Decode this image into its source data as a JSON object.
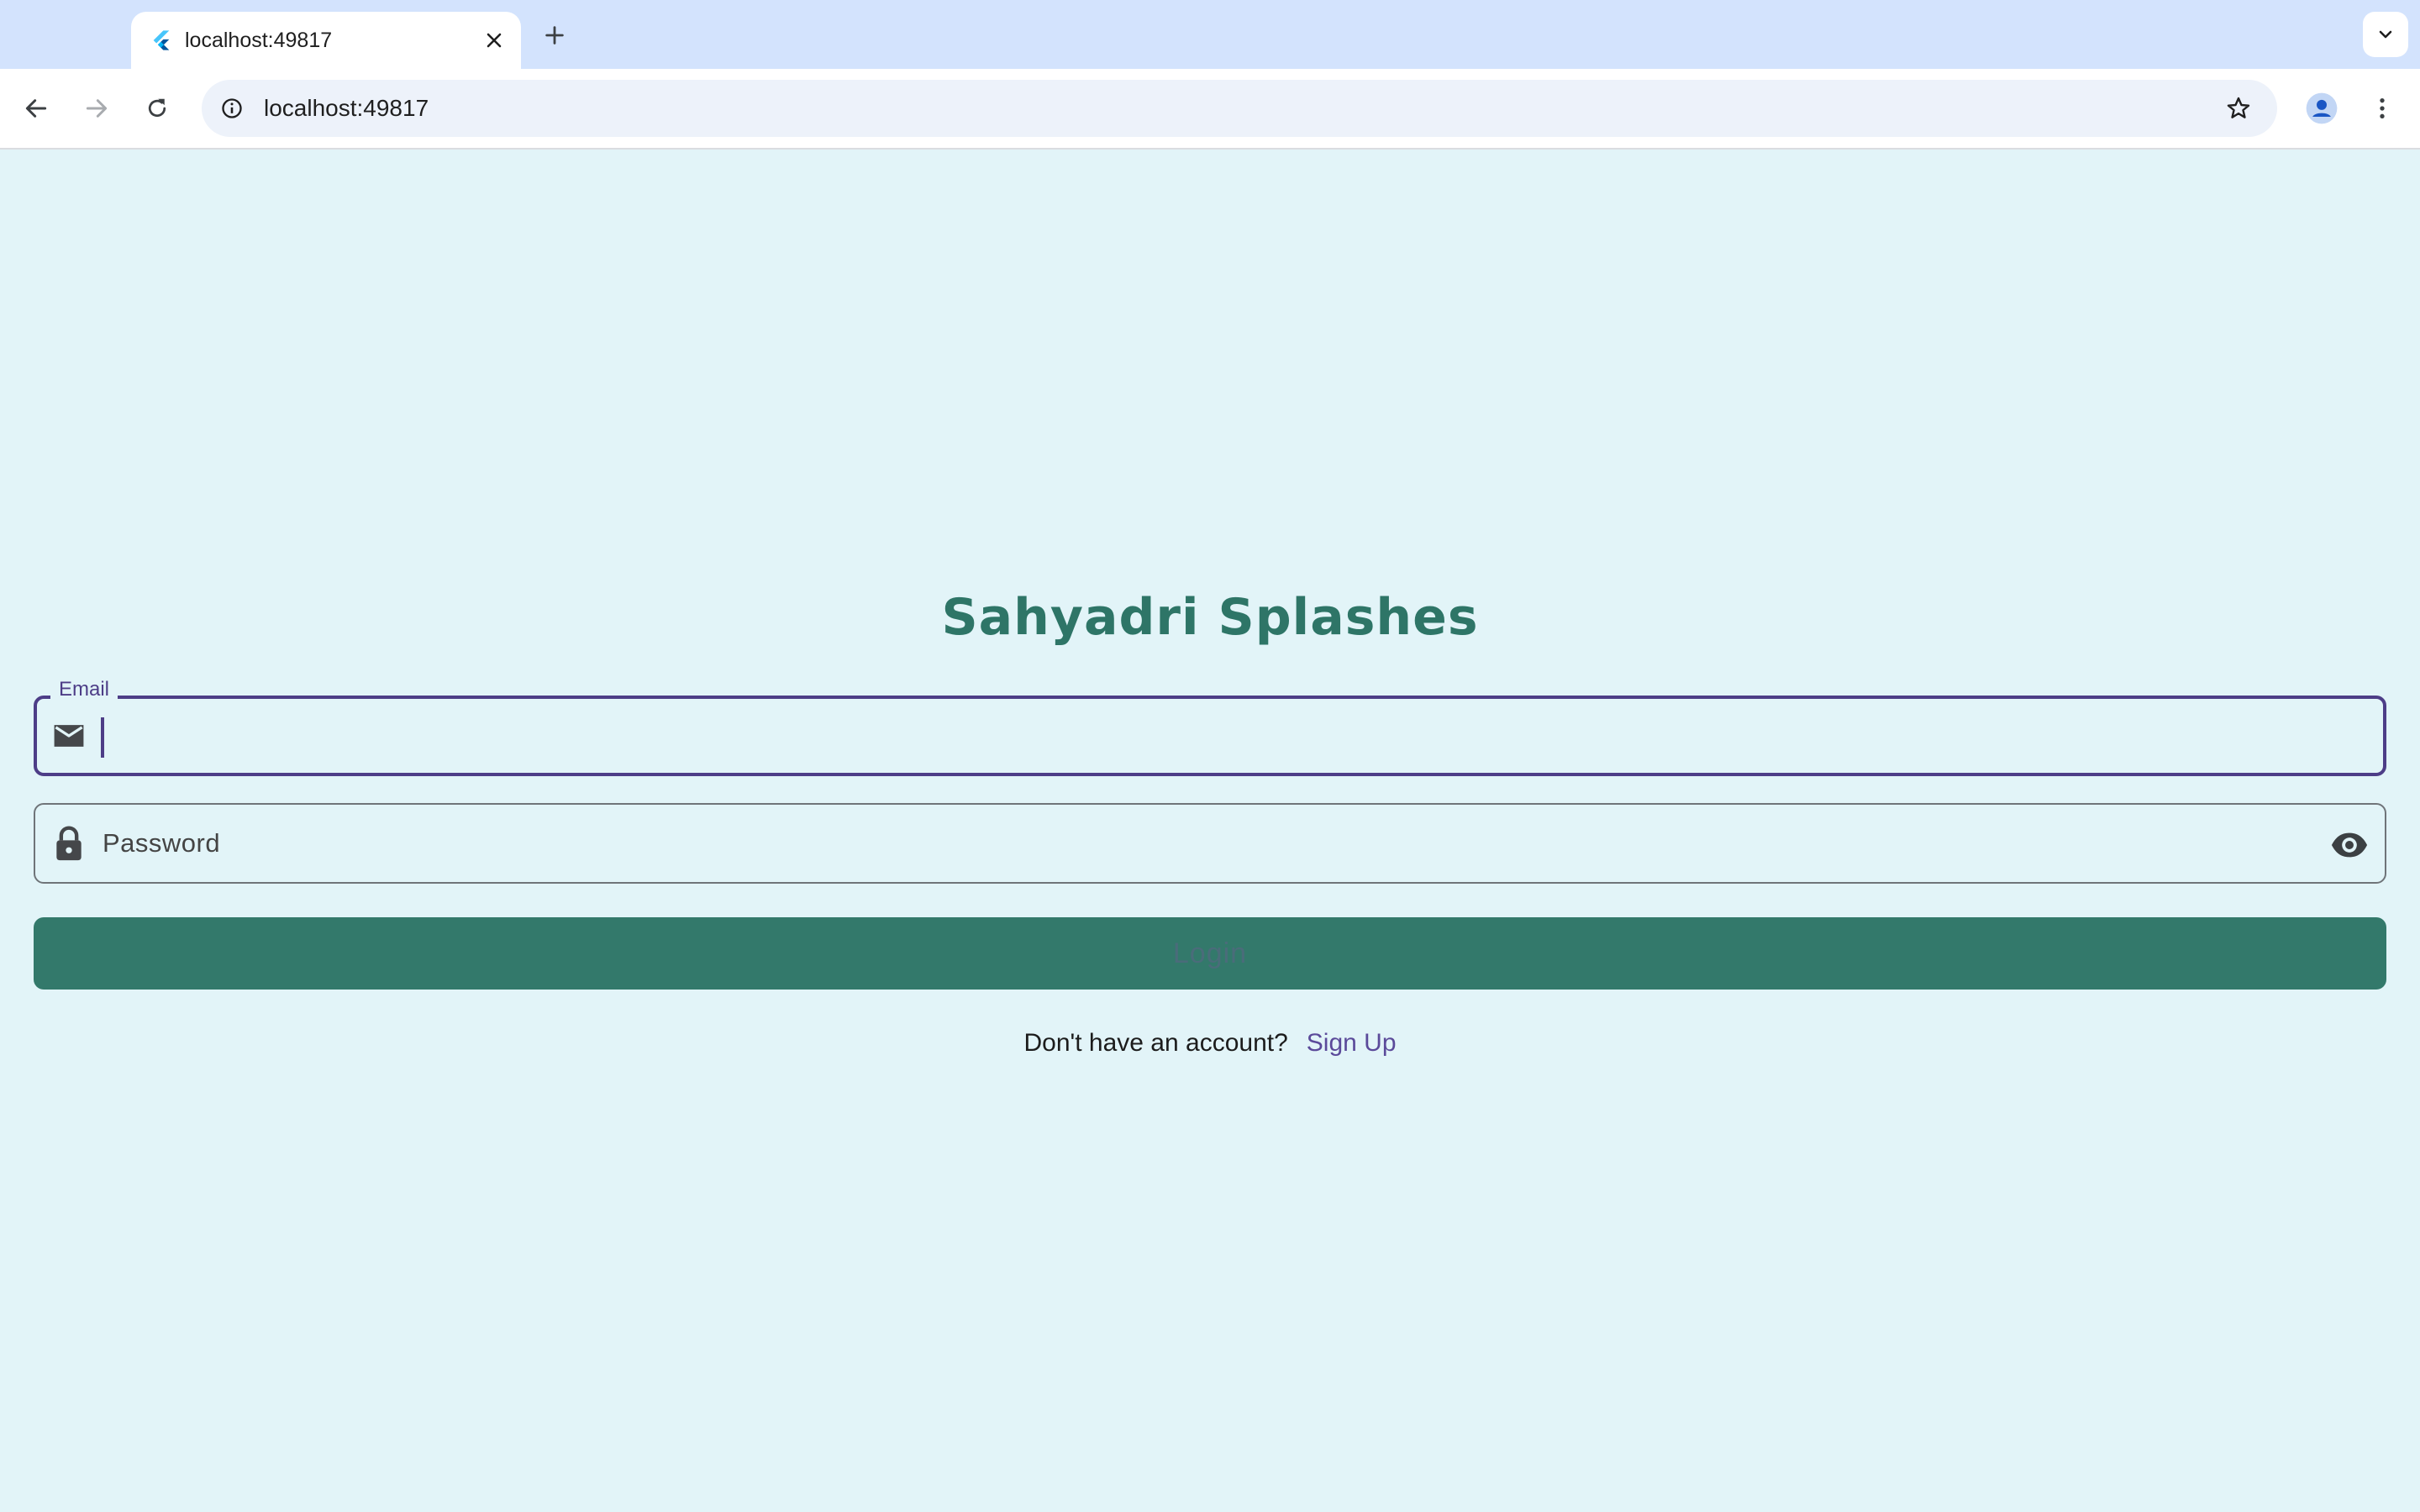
{
  "browser": {
    "tab_title": "localhost:49817",
    "url": "localhost:49817",
    "icons": {
      "favicon": "flutter-icon",
      "close": "close-icon",
      "new_tab": "plus-icon",
      "tab_list": "chevron-down-icon",
      "back": "arrow-left-icon",
      "forward": "arrow-right-icon",
      "reload": "reload-icon",
      "site_info": "info-icon",
      "bookmark": "star-icon",
      "profile": "person-icon",
      "menu": "kebab-icon"
    }
  },
  "app": {
    "title": "Sahyadri Splashes",
    "email": {
      "label": "Email",
      "value": "",
      "icon": "mail-icon"
    },
    "password": {
      "placeholder": "Password",
      "icon": "lock-icon",
      "toggle_icon": "eye-icon"
    },
    "login_label": "Login",
    "signup_prompt": "Don't have an account?",
    "signup_link": "Sign Up",
    "colors": {
      "background": "#e2f4f8",
      "primary": "#2e7567",
      "button": "#33796b",
      "focus_border": "#4d3d87",
      "link": "#5b4a9a"
    }
  }
}
